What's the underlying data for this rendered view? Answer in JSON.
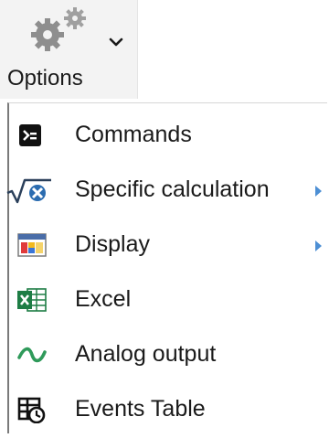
{
  "ribbon": {
    "options_label": "Options",
    "icon": "gears-icon",
    "dropdown_icon": "chevron-down-icon"
  },
  "menu": {
    "items": [
      {
        "label": "Commands",
        "icon": "terminal-icon",
        "has_submenu": false
      },
      {
        "label": "Specific calculation",
        "icon": "sqrt-calculation-icon",
        "has_submenu": true
      },
      {
        "label": "Display",
        "icon": "display-window-icon",
        "has_submenu": true
      },
      {
        "label": "Excel",
        "icon": "excel-icon",
        "has_submenu": false
      },
      {
        "label": "Analog output",
        "icon": "sine-wave-icon",
        "has_submenu": false
      },
      {
        "label": "Events Table",
        "icon": "events-table-clock-icon",
        "has_submenu": false
      }
    ]
  },
  "colors": {
    "accent_arrow": "#4d8fd4",
    "excel_green": "#1e7d45",
    "wave_green": "#2f9a5a",
    "calc_blue": "#2b6cb0"
  }
}
